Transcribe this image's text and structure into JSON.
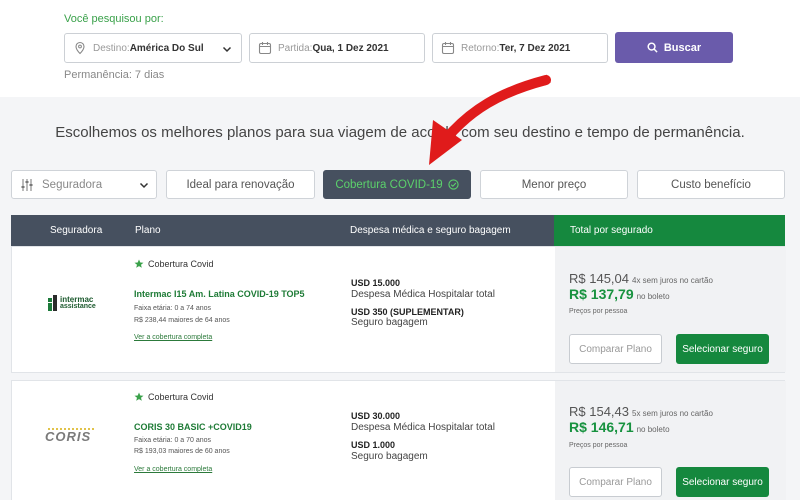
{
  "search": {
    "heading": "Você pesquisou por:",
    "destination_label": "Destino:",
    "destination_value": "América Do Sul",
    "departure_label": "Partida:",
    "departure_value": "Qua, 1 Dez 2021",
    "return_label": "Retorno:",
    "return_value": "Ter, 7 Dez 2021",
    "button_label": "Buscar",
    "stay": "Permanência: 7 dias"
  },
  "headline": "Escolhemos os melhores planos para sua viagem de acordo com seu destino e tempo de permanência.",
  "filters": {
    "insurer_placeholder": "Seguradora",
    "renewal": "Ideal para renovação",
    "covid": "Cobertura COVID-19",
    "lowest_price": "Menor preço",
    "cost_benefit": "Custo benefício"
  },
  "table_header": {
    "insurer": "Seguradora",
    "plan": "Plano",
    "coverage": "Despesa médica e seguro bagagem",
    "total": "Total por segurado"
  },
  "cards": [
    {
      "covid_label": "Cobertura Covid",
      "plan_name": "Intermac I15 Am. Latina COVID-19 TOP5",
      "age_range": "Faixa etária: 0 a 74 anos",
      "older_price": "R$ 238,44 maiores de 64 anos",
      "coverage_link": "Ver a cobertura completa",
      "medical_amount": "USD 15.000",
      "medical_desc": "Despesa Médica Hospitalar total",
      "baggage_amount": "USD 350 (SUPLEMENTAR)",
      "baggage_desc": "Seguro bagagem",
      "card_price": "R$ 145,04",
      "card_terms": "4x sem juros no cartão",
      "boleto_price": "R$ 137,79",
      "boleto_terms": "no boleto",
      "per_person": "Preços por pessoa",
      "compare_label": "Comparar Plano",
      "select_label": "Selecionar seguro"
    },
    {
      "covid_label": "Cobertura Covid",
      "plan_name": "CORIS 30 BASIC +COVID19",
      "age_range": "Faixa etária: 0 a 70 anos",
      "older_price": "R$ 193,03 maiores de 60 anos",
      "coverage_link": "Ver a cobertura completa",
      "medical_amount": "USD 30.000",
      "medical_desc": "Despesa Médica Hospitalar total",
      "baggage_amount": "USD 1.000",
      "baggage_desc": "Seguro bagagem",
      "card_price": "R$ 154,43",
      "card_terms": "5x sem juros no cartão",
      "boleto_price": "R$ 146,71",
      "boleto_terms": "no boleto",
      "per_person": "Preços por pessoa",
      "compare_label": "Comparar Plano",
      "select_label": "Selecionar seguro"
    }
  ],
  "logos": {
    "intermac_line1": "intermac",
    "intermac_line2": "assistance",
    "coris": "CORIS"
  },
  "colors": {
    "accent_green": "#15883e",
    "button_purple": "#6a5bab",
    "dark_header": "#46505f",
    "arrow_red": "#e01b1b"
  }
}
